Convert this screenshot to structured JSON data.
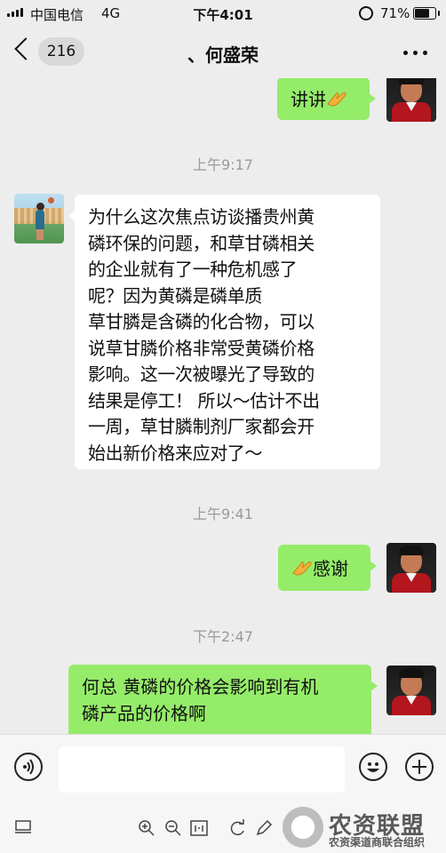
{
  "status_bar": {
    "carrier": "中国电信",
    "network": "4G",
    "time": "下午4:01",
    "battery": "71%"
  },
  "header": {
    "back_count": "216",
    "title": "、何盛荣",
    "back_icon": "chevron-left-icon",
    "more_icon": "ellipsis-icon"
  },
  "messages": [
    {
      "side": "right",
      "text": "讲讲",
      "emoji": "praying-hands"
    },
    {
      "type": "timestamp",
      "text": "上午9:17"
    },
    {
      "side": "left",
      "text": "为什么这次焦点访谈播贵州黄\n磷环保的问题，和草甘磷相关\n的企业就有了一种危机感了\n呢？因为黄磷是磷单质\n草甘膦是含磷的化合物，可以\n说草甘膦价格非常受黄磷价格\n影响。这一次被曝光了导致的\n结果是停工！ 所以～估计不出\n一周，草甘膦制剂厂家都会开\n始出新价格来应对了～"
    },
    {
      "type": "timestamp",
      "text": "上午9:41"
    },
    {
      "side": "right",
      "text": "感谢",
      "emoji": "praying-hands"
    },
    {
      "type": "timestamp",
      "text": "下午2:47"
    },
    {
      "side": "right",
      "text": "何总 黄磷的价格会影响到有机\n磷产品的价格啊"
    }
  ],
  "input": {
    "value": "",
    "placeholder": ""
  },
  "colors": {
    "sent_bubble": "#95ec69",
    "received_bubble": "#ffffff",
    "background": "#ededed"
  },
  "watermark": {
    "title": "农资联盟",
    "subtitle": "农资渠道商联合组织"
  }
}
